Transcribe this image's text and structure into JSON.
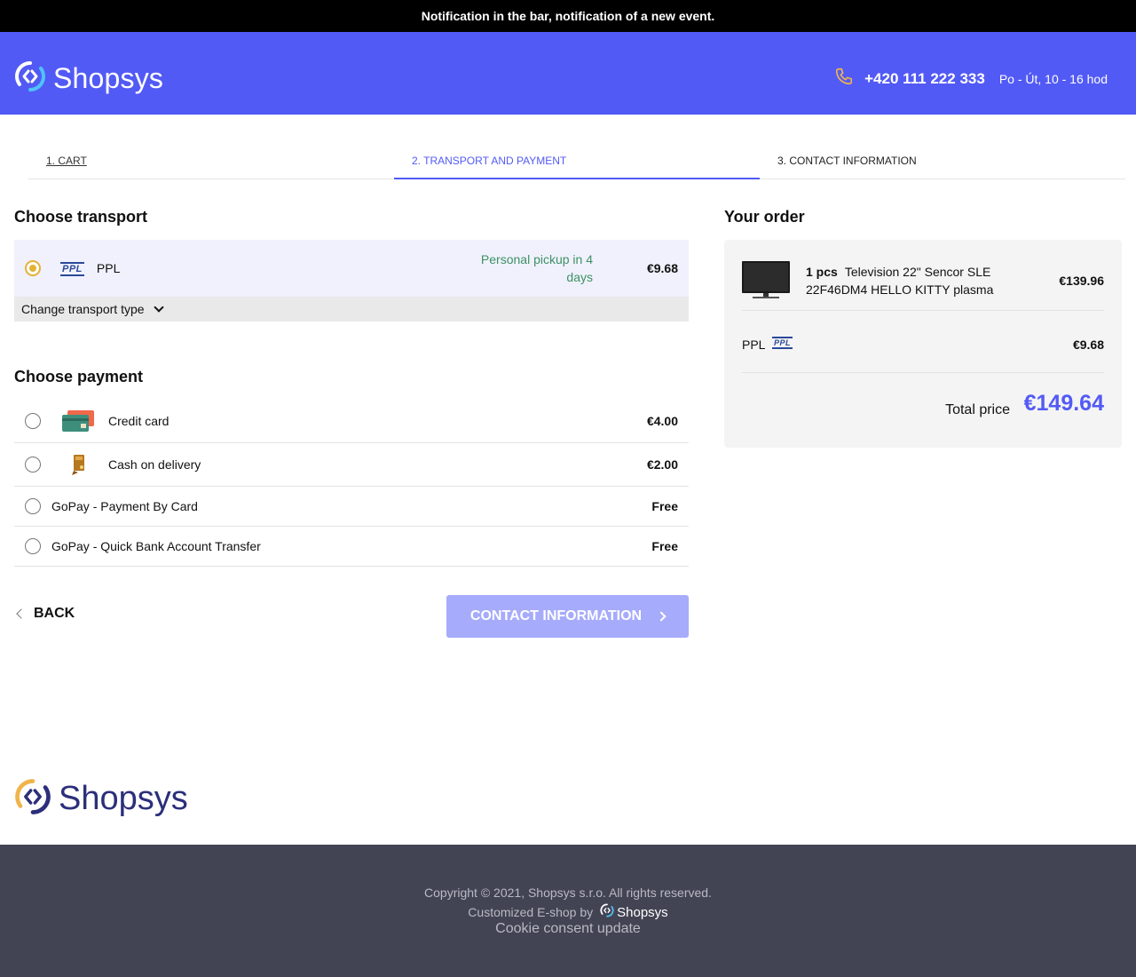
{
  "notification": "Notification in the bar, notification of a new event.",
  "header": {
    "logo_text": "Shopsys",
    "phone": "+420 111 222 333",
    "hours": "Po - Út, 10 - 16 hod"
  },
  "steps": [
    {
      "label": "1. CART",
      "state": "done"
    },
    {
      "label": "2. TRANSPORT AND PAYMENT",
      "state": "active"
    },
    {
      "label": "3. CONTACT INFORMATION",
      "state": "todo"
    }
  ],
  "transport": {
    "title": "Choose transport",
    "selected": {
      "logo_text": "PPL",
      "name": "PPL",
      "delivery": "Personal pickup in 4 days",
      "price": "€9.68"
    },
    "change_label": "Change transport type"
  },
  "payment": {
    "title": "Choose payment",
    "options": [
      {
        "name": "Credit card",
        "price": "€4.00",
        "icon": "credit-card-icon"
      },
      {
        "name": "Cash on delivery",
        "price": "€2.00",
        "icon": "cash-on-delivery-icon"
      },
      {
        "name": "GoPay - Payment By Card",
        "price": "Free"
      },
      {
        "name": "GoPay - Quick Bank Account Transfer",
        "price": "Free"
      }
    ]
  },
  "nav": {
    "back_label": "BACK",
    "next_label": "CONTACT INFORMATION"
  },
  "order": {
    "title": "Your order",
    "item": {
      "qty": "1 pcs",
      "name": "Television 22\" Sencor SLE 22F46DM4 HELLO KITTY plasma",
      "price": "€139.96"
    },
    "shipping": {
      "name": "PPL",
      "logo_text": "PPL",
      "price": "€9.68"
    },
    "total_label": "Total price",
    "total_value": "€149.64"
  },
  "footer": {
    "logo_text": "Shopsys",
    "copyright": "Copyright © 2021, Shopsys s.r.o. All rights reserved.",
    "customized": "Customized E-shop by",
    "customized_brand": "Shopsys",
    "cookie": "Cookie consent update"
  },
  "colors": {
    "brand": "#525af5",
    "accent": "#e3b235",
    "pickup_green": "#3c9163",
    "footer_bg": "#424454"
  }
}
